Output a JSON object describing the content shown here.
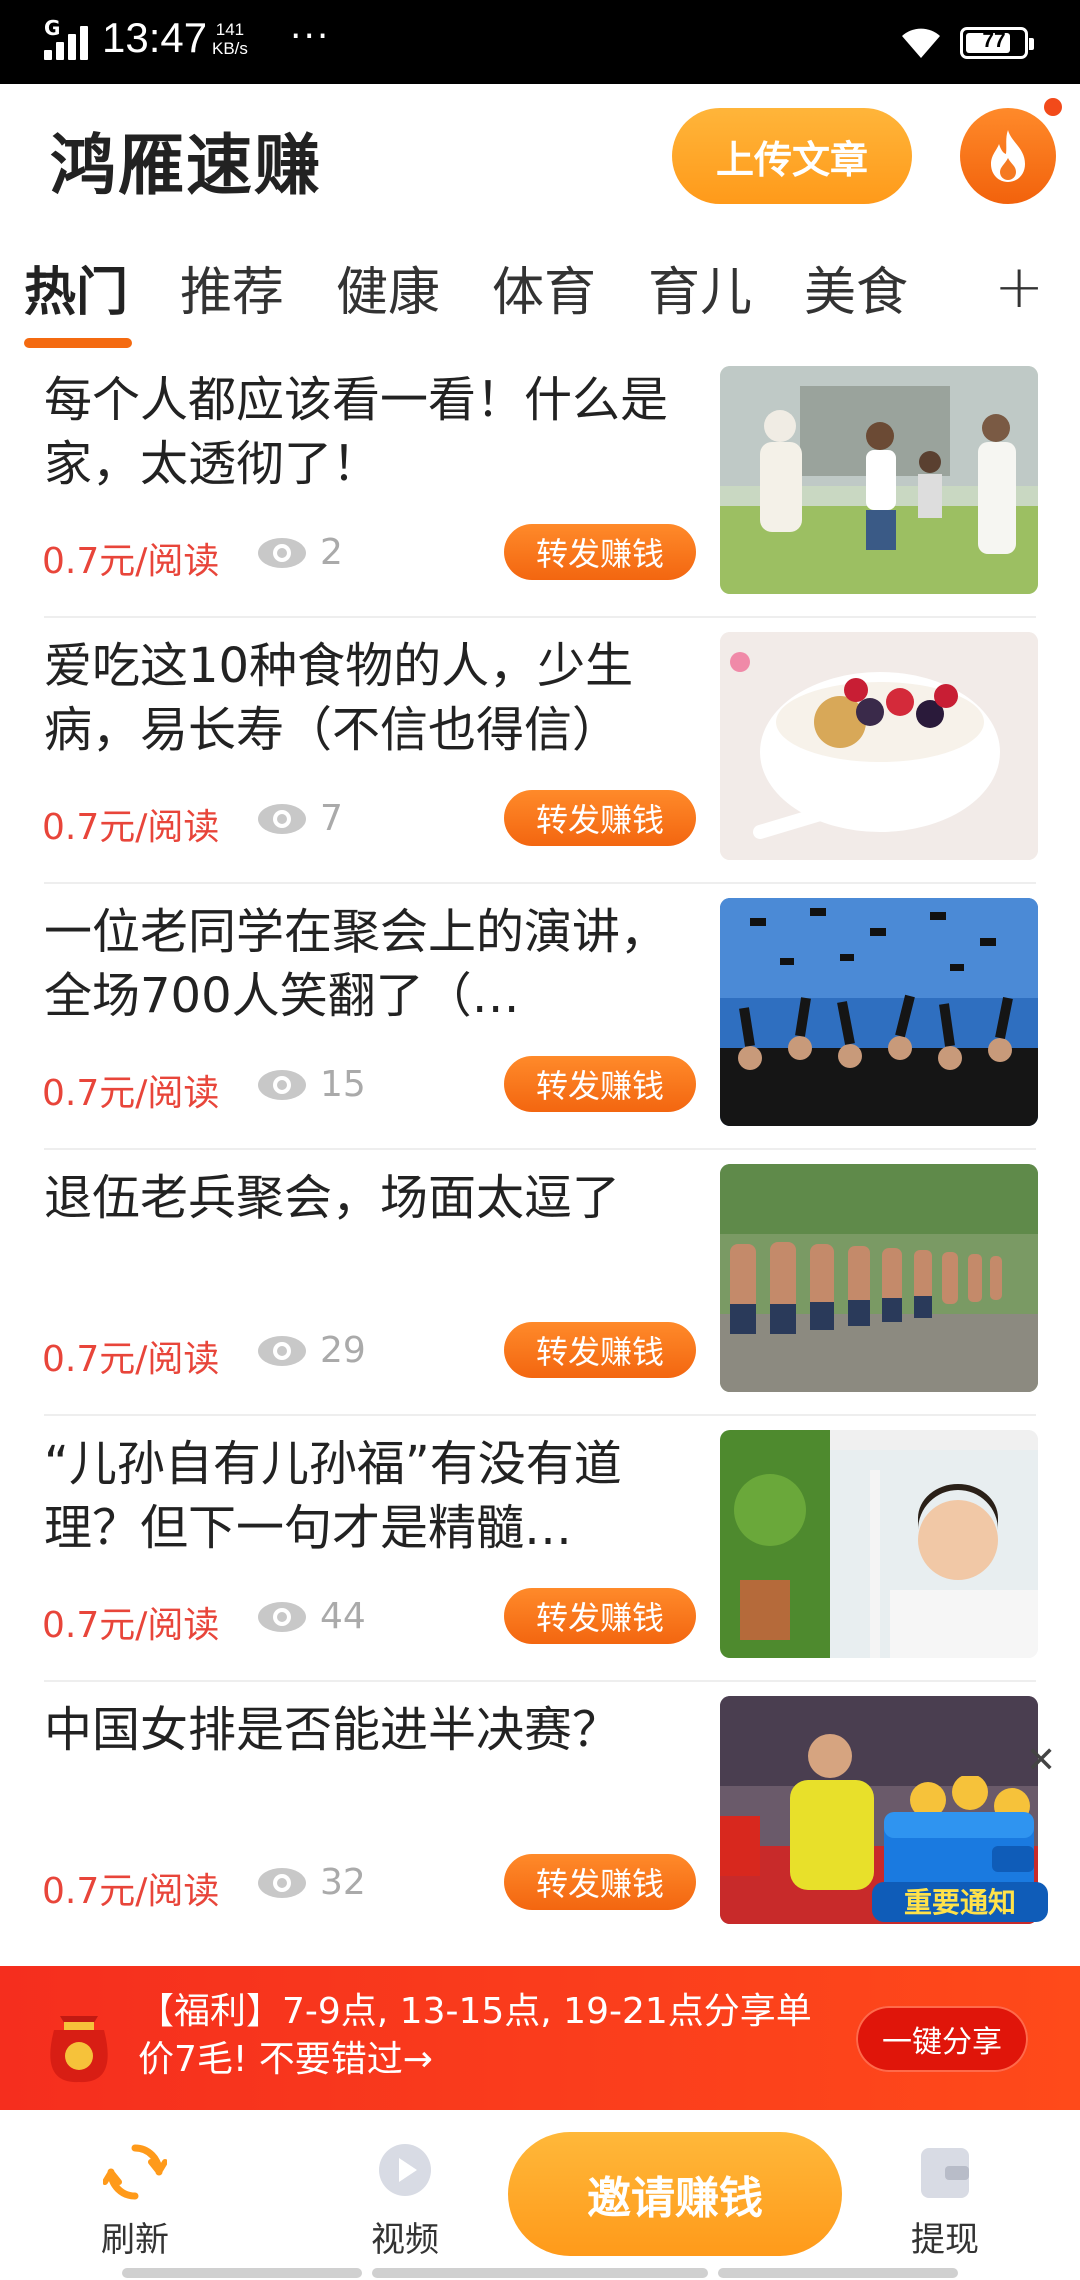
{
  "status_bar": {
    "network": "G",
    "time": "13:47",
    "speed_value": "141",
    "speed_unit": "KB/s",
    "more": "···",
    "battery": "77"
  },
  "header": {
    "title": "鸿雁速赚",
    "upload_label": "上传文章",
    "hot_icon": "fire-icon"
  },
  "tabs": [
    {
      "label": "热门",
      "active": true
    },
    {
      "label": "推荐",
      "active": false
    },
    {
      "label": "健康",
      "active": false
    },
    {
      "label": "体育",
      "active": false
    },
    {
      "label": "育儿",
      "active": false
    },
    {
      "label": "美食",
      "active": false
    }
  ],
  "tab_add": "+",
  "articles": [
    {
      "title": "每个人都应该看一看！什么是家，太透彻了！",
      "price": "0.7元/阅读",
      "views": "2",
      "share_label": "转发赚钱"
    },
    {
      "title": "爱吃这10种食物的人，少生病，易长寿（不信也得信）",
      "price": "0.7元/阅读",
      "views": "7",
      "share_label": "转发赚钱"
    },
    {
      "title": "一位老同学在聚会上的演讲，全场700人笑翻了（…",
      "price": "0.7元/阅读",
      "views": "15",
      "share_label": "转发赚钱"
    },
    {
      "title": "退伍老兵聚会，场面太逗了",
      "price": "0.7元/阅读",
      "views": "29",
      "share_label": "转发赚钱"
    },
    {
      "title": "“儿孙自有儿孙福”有没有道理？但下一句才是精髓…",
      "price": "0.7元/阅读",
      "views": "44",
      "share_label": "转发赚钱"
    },
    {
      "title": "中国女排是否能进半决赛？",
      "price": "0.7元/阅读",
      "views": "32",
      "share_label": "转发赚钱"
    }
  ],
  "notice": {
    "label": "重要通知",
    "close": "✕"
  },
  "promo": {
    "text": "【福利】7-9点, 13-15点, 19-21点分享单价7毛! 不要错过→",
    "button": "一键分享"
  },
  "bottom_nav": {
    "refresh": "刷新",
    "video": "视频",
    "invite": "邀请赚钱",
    "withdraw": "提现"
  },
  "colors": {
    "accent": "#f46a10",
    "price": "#e8453a",
    "promo_bg": "#f52e1e"
  }
}
